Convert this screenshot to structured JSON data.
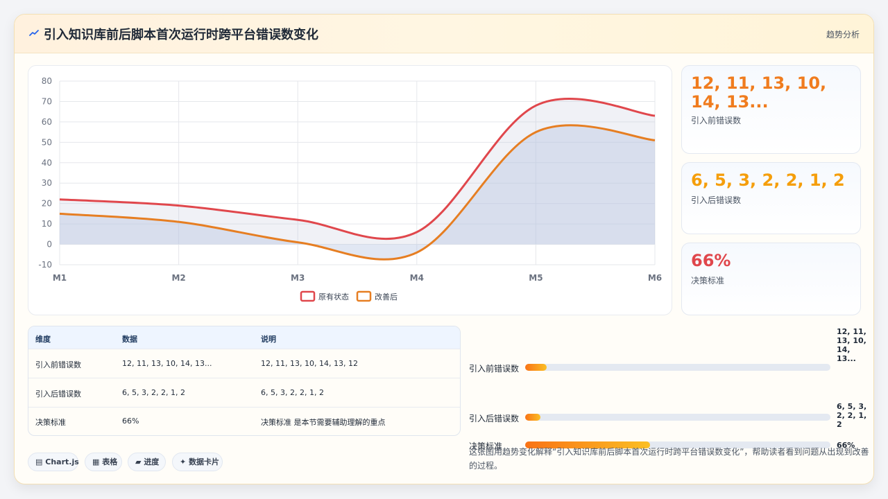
{
  "header": {
    "title": "引入知识库前后脚本首次运行时跨平台错误数变化",
    "tag": "趋势分析"
  },
  "colors": {
    "series_before": "#e0474c",
    "series_after": "#e67e22",
    "stat_before": "#f07c1e",
    "stat_after": "#f59e0b",
    "stat_standard": "#e0474c"
  },
  "chart_data": {
    "type": "area",
    "categories": [
      "M1",
      "M2",
      "M3",
      "M4",
      "M5",
      "M6"
    ],
    "ylim": [
      -10,
      80
    ],
    "yticks": [
      -10,
      0,
      10,
      20,
      30,
      40,
      50,
      60,
      70,
      80
    ],
    "grid": true,
    "legend_position": "bottom",
    "series": [
      {
        "name": "原有状态",
        "values": [
          22,
          19,
          12,
          6,
          68,
          63
        ]
      },
      {
        "name": "改善后",
        "values": [
          15,
          11,
          1,
          -4,
          55,
          51
        ]
      }
    ]
  },
  "stats": [
    {
      "value": "12, 11, 13, 10, 14, 13...",
      "label": "引入前错误数"
    },
    {
      "value": "6, 5, 3, 2, 2, 1, 2",
      "label": "引入后错误数"
    },
    {
      "value": "66%",
      "label": "决策标准"
    }
  ],
  "table": {
    "headers": [
      "维度",
      "数据",
      "说明"
    ],
    "rows": [
      [
        "引入前错误数",
        "12, 11, 13, 10, 14, 13...",
        "12, 11, 13, 10, 14, 13, 12"
      ],
      [
        "引入后错误数",
        "6, 5, 3, 2, 2, 1, 2",
        "6, 5, 3, 2, 2, 1, 2"
      ],
      [
        "决策标准",
        "66%",
        "决策标准 是本节需要辅助理解的重点"
      ]
    ]
  },
  "chips": [
    {
      "label": "Chart.js",
      "icon": "bar-chart-icon"
    },
    {
      "label": "表格",
      "icon": "table-icon"
    },
    {
      "label": "进度",
      "icon": "progress-icon"
    },
    {
      "label": "数据卡片",
      "icon": "sparkle-icon"
    }
  ],
  "progress": [
    {
      "label": "引入前错误数",
      "value_text": "12, 11, 13, 10, 14, 13...",
      "fraction": 0.07
    },
    {
      "label": "引入后错误数",
      "value_text": "6, 5, 3, 2, 2, 1, 2",
      "fraction": 0.05
    },
    {
      "label": "决策标准",
      "value_text": "66%",
      "fraction": 0.41
    }
  ],
  "description": "这张图用趋势变化解释“引入知识库前后脚本首次运行时跨平台错误数变化”，帮助读者看到问题从出现到改善的过程。"
}
